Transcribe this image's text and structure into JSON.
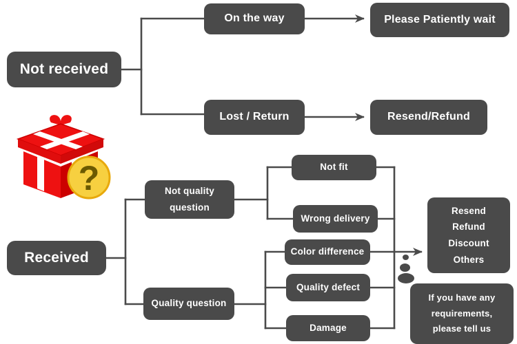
{
  "diagram": {
    "title": "Order status support flowchart",
    "accent_color": "#4a4a4a",
    "line_color": "#4a4a4a",
    "text_color": "#ffffff",
    "background": "#ffffff",
    "gift_colors": {
      "box_red": "#ee1111",
      "box_red_dark": "#cc0000",
      "ribbon_white": "#ffffff",
      "badge_yellow": "#f5c518",
      "badge_mark": "#6b5a00"
    }
  },
  "nodes": {
    "not_received": "Not received",
    "on_the_way": "On the way",
    "please_patiently_wait": "Please Patiently wait",
    "lost_return": "Lost / Return",
    "resend_refund": "Resend/Refund",
    "received": "Received",
    "not_quality_question_line1": "Not quality",
    "not_quality_question_line2": "question",
    "quality_question": "Quality question",
    "not_fit": "Not fit",
    "wrong_delivery": "Wrong delivery",
    "color_difference": "Color difference",
    "quality_defect": "Quality defect",
    "damage": "Damage",
    "outcome_line1": "Resend",
    "outcome_line2": "Refund",
    "outcome_line3": "Discount",
    "outcome_line4": "Others",
    "callout_line1": "If you have any",
    "callout_line2": "requirements,",
    "callout_line3": "please tell us"
  },
  "icons": {
    "gift_box": "gift-box-icon",
    "question_badge": "question-mark-badge-icon",
    "speech_tail": "speech-bubble-tail-dots"
  }
}
